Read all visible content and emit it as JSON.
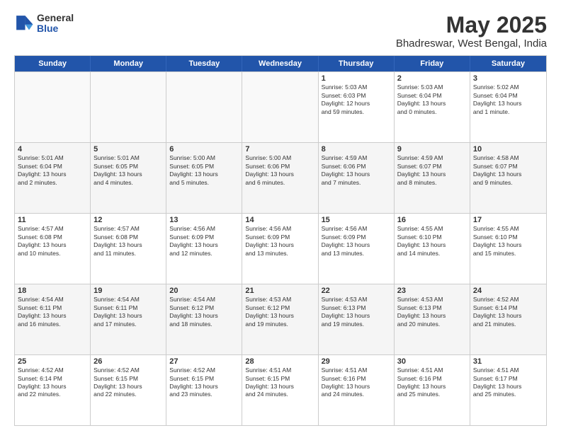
{
  "logo": {
    "general": "General",
    "blue": "Blue"
  },
  "header": {
    "title": "May 2025",
    "subtitle": "Bhadreswar, West Bengal, India"
  },
  "weekdays": [
    "Sunday",
    "Monday",
    "Tuesday",
    "Wednesday",
    "Thursday",
    "Friday",
    "Saturday"
  ],
  "rows": [
    [
      {
        "day": "",
        "empty": true
      },
      {
        "day": "",
        "empty": true
      },
      {
        "day": "",
        "empty": true
      },
      {
        "day": "",
        "empty": true
      },
      {
        "day": "1",
        "lines": [
          "Sunrise: 5:03 AM",
          "Sunset: 6:03 PM",
          "Daylight: 12 hours",
          "and 59 minutes."
        ]
      },
      {
        "day": "2",
        "lines": [
          "Sunrise: 5:03 AM",
          "Sunset: 6:04 PM",
          "Daylight: 13 hours",
          "and 0 minutes."
        ]
      },
      {
        "day": "3",
        "lines": [
          "Sunrise: 5:02 AM",
          "Sunset: 6:04 PM",
          "Daylight: 13 hours",
          "and 1 minute."
        ]
      }
    ],
    [
      {
        "day": "4",
        "lines": [
          "Sunrise: 5:01 AM",
          "Sunset: 6:04 PM",
          "Daylight: 13 hours",
          "and 2 minutes."
        ]
      },
      {
        "day": "5",
        "lines": [
          "Sunrise: 5:01 AM",
          "Sunset: 6:05 PM",
          "Daylight: 13 hours",
          "and 4 minutes."
        ]
      },
      {
        "day": "6",
        "lines": [
          "Sunrise: 5:00 AM",
          "Sunset: 6:05 PM",
          "Daylight: 13 hours",
          "and 5 minutes."
        ]
      },
      {
        "day": "7",
        "lines": [
          "Sunrise: 5:00 AM",
          "Sunset: 6:06 PM",
          "Daylight: 13 hours",
          "and 6 minutes."
        ]
      },
      {
        "day": "8",
        "lines": [
          "Sunrise: 4:59 AM",
          "Sunset: 6:06 PM",
          "Daylight: 13 hours",
          "and 7 minutes."
        ]
      },
      {
        "day": "9",
        "lines": [
          "Sunrise: 4:59 AM",
          "Sunset: 6:07 PM",
          "Daylight: 13 hours",
          "and 8 minutes."
        ]
      },
      {
        "day": "10",
        "lines": [
          "Sunrise: 4:58 AM",
          "Sunset: 6:07 PM",
          "Daylight: 13 hours",
          "and 9 minutes."
        ]
      }
    ],
    [
      {
        "day": "11",
        "lines": [
          "Sunrise: 4:57 AM",
          "Sunset: 6:08 PM",
          "Daylight: 13 hours",
          "and 10 minutes."
        ]
      },
      {
        "day": "12",
        "lines": [
          "Sunrise: 4:57 AM",
          "Sunset: 6:08 PM",
          "Daylight: 13 hours",
          "and 11 minutes."
        ]
      },
      {
        "day": "13",
        "lines": [
          "Sunrise: 4:56 AM",
          "Sunset: 6:09 PM",
          "Daylight: 13 hours",
          "and 12 minutes."
        ]
      },
      {
        "day": "14",
        "lines": [
          "Sunrise: 4:56 AM",
          "Sunset: 6:09 PM",
          "Daylight: 13 hours",
          "and 13 minutes."
        ]
      },
      {
        "day": "15",
        "lines": [
          "Sunrise: 4:56 AM",
          "Sunset: 6:09 PM",
          "Daylight: 13 hours",
          "and 13 minutes."
        ]
      },
      {
        "day": "16",
        "lines": [
          "Sunrise: 4:55 AM",
          "Sunset: 6:10 PM",
          "Daylight: 13 hours",
          "and 14 minutes."
        ]
      },
      {
        "day": "17",
        "lines": [
          "Sunrise: 4:55 AM",
          "Sunset: 6:10 PM",
          "Daylight: 13 hours",
          "and 15 minutes."
        ]
      }
    ],
    [
      {
        "day": "18",
        "lines": [
          "Sunrise: 4:54 AM",
          "Sunset: 6:11 PM",
          "Daylight: 13 hours",
          "and 16 minutes."
        ]
      },
      {
        "day": "19",
        "lines": [
          "Sunrise: 4:54 AM",
          "Sunset: 6:11 PM",
          "Daylight: 13 hours",
          "and 17 minutes."
        ]
      },
      {
        "day": "20",
        "lines": [
          "Sunrise: 4:54 AM",
          "Sunset: 6:12 PM",
          "Daylight: 13 hours",
          "and 18 minutes."
        ]
      },
      {
        "day": "21",
        "lines": [
          "Sunrise: 4:53 AM",
          "Sunset: 6:12 PM",
          "Daylight: 13 hours",
          "and 19 minutes."
        ]
      },
      {
        "day": "22",
        "lines": [
          "Sunrise: 4:53 AM",
          "Sunset: 6:13 PM",
          "Daylight: 13 hours",
          "and 19 minutes."
        ]
      },
      {
        "day": "23",
        "lines": [
          "Sunrise: 4:53 AM",
          "Sunset: 6:13 PM",
          "Daylight: 13 hours",
          "and 20 minutes."
        ]
      },
      {
        "day": "24",
        "lines": [
          "Sunrise: 4:52 AM",
          "Sunset: 6:14 PM",
          "Daylight: 13 hours",
          "and 21 minutes."
        ]
      }
    ],
    [
      {
        "day": "25",
        "lines": [
          "Sunrise: 4:52 AM",
          "Sunset: 6:14 PM",
          "Daylight: 13 hours",
          "and 22 minutes."
        ]
      },
      {
        "day": "26",
        "lines": [
          "Sunrise: 4:52 AM",
          "Sunset: 6:15 PM",
          "Daylight: 13 hours",
          "and 22 minutes."
        ]
      },
      {
        "day": "27",
        "lines": [
          "Sunrise: 4:52 AM",
          "Sunset: 6:15 PM",
          "Daylight: 13 hours",
          "and 23 minutes."
        ]
      },
      {
        "day": "28",
        "lines": [
          "Sunrise: 4:51 AM",
          "Sunset: 6:15 PM",
          "Daylight: 13 hours",
          "and 24 minutes."
        ]
      },
      {
        "day": "29",
        "lines": [
          "Sunrise: 4:51 AM",
          "Sunset: 6:16 PM",
          "Daylight: 13 hours",
          "and 24 minutes."
        ]
      },
      {
        "day": "30",
        "lines": [
          "Sunrise: 4:51 AM",
          "Sunset: 6:16 PM",
          "Daylight: 13 hours",
          "and 25 minutes."
        ]
      },
      {
        "day": "31",
        "lines": [
          "Sunrise: 4:51 AM",
          "Sunset: 6:17 PM",
          "Daylight: 13 hours",
          "and 25 minutes."
        ]
      }
    ]
  ]
}
